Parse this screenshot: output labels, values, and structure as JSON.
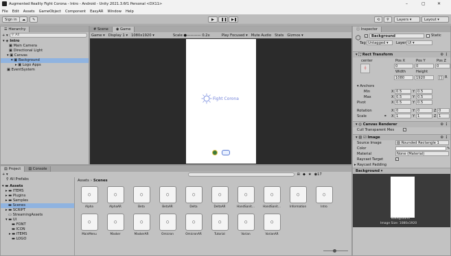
{
  "window": {
    "title": "Augmented Reality Fight Corona - Intro - Android - Unity 2021.3.6f1 Personal <DX11>",
    "minimize": "–",
    "maximize": "▢",
    "close": "✕"
  },
  "menu": [
    "File",
    "Edit",
    "Assets",
    "GameObject",
    "Component",
    "EasyAR",
    "Window",
    "Help"
  ],
  "toolbar": {
    "signin": "Sign in",
    "layers": "Layers",
    "layout": "Layout"
  },
  "hierarchy": {
    "tab": "Hierarchy",
    "search_placeholder": "All",
    "items": [
      {
        "label": "Intro"
      },
      {
        "label": "Main Camera"
      },
      {
        "label": "Directional Light"
      },
      {
        "label": "Canvas"
      },
      {
        "label": "Background"
      },
      {
        "label": "Logo Apps"
      },
      {
        "label": "EventSystem"
      }
    ]
  },
  "scene": {
    "tabs": [
      "Scene",
      "Game"
    ],
    "display_mode": "Game",
    "display": "Display 1",
    "resolution": "1080x1920",
    "scale_label": "Scale",
    "scale_value": "0.2x",
    "options": [
      "Play Focused",
      "Mute Audio",
      "Stats",
      "Gizmos"
    ],
    "logo_text": "Fight Corona"
  },
  "project": {
    "tabs": [
      "Project",
      "Console"
    ],
    "breadcrumb": [
      "Assets",
      "Scenes"
    ],
    "count": "17",
    "all_prefabs": "All Prefabs",
    "tree": [
      {
        "label": "Assets"
      },
      {
        "label": "ITEMS"
      },
      {
        "label": "Plugins"
      },
      {
        "label": "Samples"
      },
      {
        "label": "Scenes"
      },
      {
        "label": "SCRIPT"
      },
      {
        "label": "StreamingAssets"
      },
      {
        "label": "UI"
      },
      {
        "label": "FONT"
      },
      {
        "label": "ICON"
      },
      {
        "label": "ITEMS"
      },
      {
        "label": "LOGO"
      }
    ],
    "row1": [
      "Alpha",
      "AlphaAR",
      "Beta",
      "BetaAR",
      "Delta",
      "DeltaAR",
      "HandSanit...",
      "HandSanit...",
      "Information",
      "Intro"
    ],
    "row2": [
      "MainMenu",
      "Masker",
      "MaskerAR",
      "Omicron",
      "OmicronAR",
      "Tutorial",
      "Varian",
      "VarianAR"
    ]
  },
  "inspector": {
    "tab": "Inspector",
    "object_name": "Background",
    "static_label": "Static",
    "tag_label": "Tag",
    "tag_value": "Untagged",
    "layer_label": "Layer",
    "layer_value": "UI",
    "rect_transform": {
      "title": "Rect Transform",
      "anchor_mode": "center",
      "pos_x_label": "Pos X",
      "pos_y_label": "Pos Y",
      "pos_z_label": "Pos Z",
      "pos_x": "0",
      "pos_y": "0",
      "pos_z": "0",
      "width_label": "Width",
      "height_label": "Height",
      "width": "1080",
      "height": "1920",
      "anchors_label": "Anchors",
      "min_label": "Min",
      "max_label": "Max",
      "pivot_label": "Pivot",
      "x_label": "X",
      "y_label": "Y",
      "z_label": "Z",
      "min_x": "0.5",
      "min_y": "0.5",
      "max_x": "0.5",
      "max_y": "0.5",
      "pivot_x": "0.5",
      "pivot_y": "0.5",
      "rotation_label": "Rotation",
      "rot_x": "0",
      "rot_y": "0",
      "rot_z": "0",
      "scale_label": "Scale",
      "scale_x": "1",
      "scale_y": "1",
      "scale_z": "1"
    },
    "canvas_renderer": {
      "title": "Canvas Renderer",
      "cull_label": "Cull Transparent Mes"
    },
    "image": {
      "title": "Image",
      "source_label": "Source Image",
      "source_value": "Rounded Rectangle 1",
      "color_label": "Color",
      "material_label": "Material",
      "material_value": "None (Material)",
      "raycast_target_label": "Raycast Target",
      "raycast_padding_label": "Raycast Padding"
    },
    "preview_tab": "Background",
    "preview_caption": "Background",
    "preview_size": "Image Size: 1080x1920"
  }
}
